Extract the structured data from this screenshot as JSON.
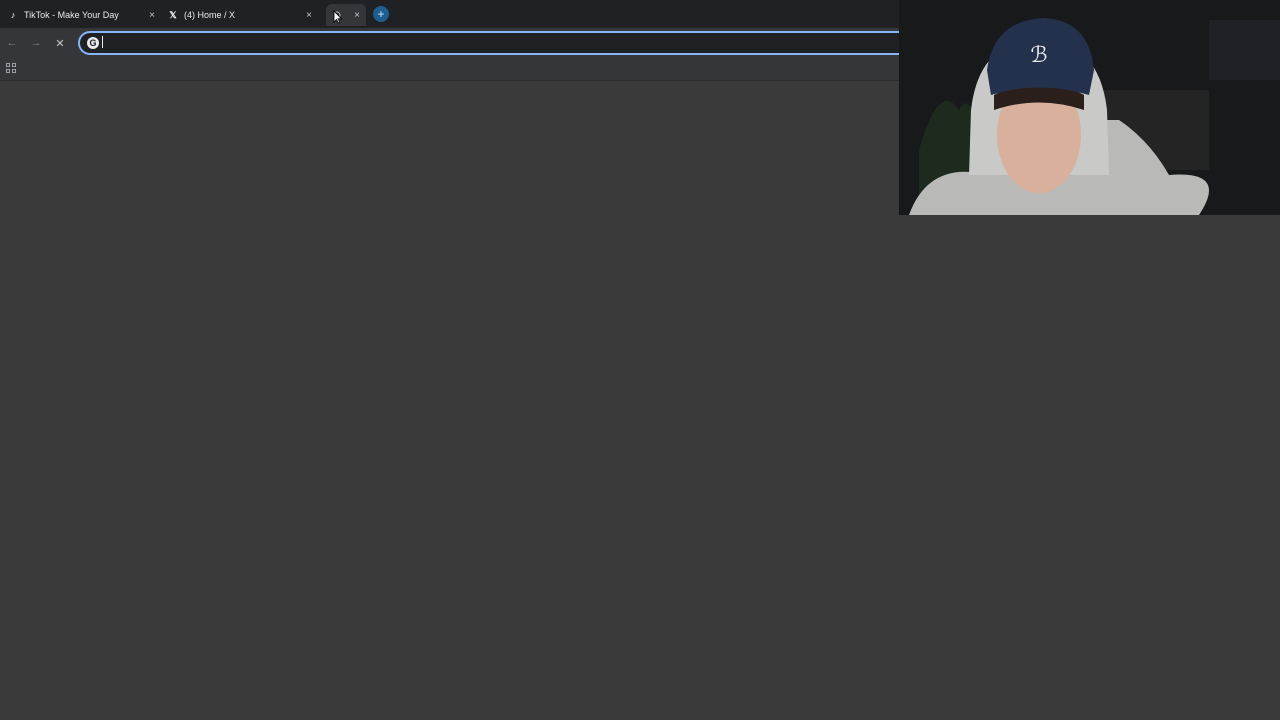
{
  "tabs": [
    {
      "title": "TikTok - Make Your Day",
      "favicon": "tiktok-icon",
      "close": "×"
    },
    {
      "title": "(4) Home / X",
      "favicon": "x-icon",
      "close": "×"
    },
    {
      "title": "",
      "favicon": "loading-icon",
      "close": "×",
      "active": true
    }
  ],
  "new_tab": {
    "label": "+"
  },
  "toolbar": {
    "back": "←",
    "forward": "→",
    "stop": "✕",
    "omnibox": {
      "value": "",
      "placeholder": ""
    },
    "search_engine_icon": "G"
  },
  "bookmarks_bar": {
    "apps_icon": "apps-grid-icon"
  },
  "webcam": {
    "description_icon": "webcam-overlay"
  },
  "colors": {
    "page_bg": "#3a3a3a",
    "tabstrip_bg": "#202124",
    "toolbar_bg": "#35363a",
    "focus_ring": "#8ab4f8",
    "new_tab_button": "#1f5d8f"
  }
}
